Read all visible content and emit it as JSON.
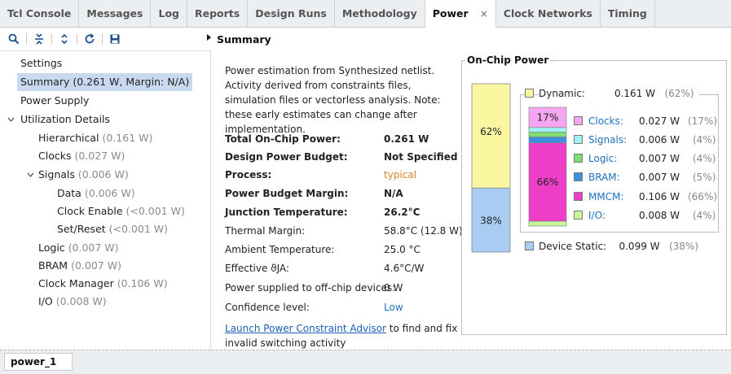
{
  "tabs": [
    {
      "label": "Tcl Console"
    },
    {
      "label": "Messages"
    },
    {
      "label": "Log"
    },
    {
      "label": "Reports"
    },
    {
      "label": "Design Runs"
    },
    {
      "label": "Methodology"
    },
    {
      "label": "Power",
      "active": true,
      "close": "×"
    },
    {
      "label": "Clock Networks"
    },
    {
      "label": "Timing"
    }
  ],
  "toolbar_icons": [
    "search-icon",
    "collapse-all-icon",
    "expand-all-icon",
    "refresh-icon",
    "save-icon"
  ],
  "summary_header": "Summary",
  "tree": {
    "settings": "Settings",
    "summary": "Summary (0.261 W, Margin: N/A)",
    "power_supply": "Power Supply",
    "utilization": "Utilization Details",
    "hierarchical": {
      "label": "Hierarchical",
      "value": "(0.161 W)"
    },
    "clocks": {
      "label": "Clocks",
      "value": "(0.027 W)"
    },
    "signals": {
      "label": "Signals",
      "value": "(0.006 W)"
    },
    "data": {
      "label": "Data",
      "value": "(0.006 W)"
    },
    "clock_enable": {
      "label": "Clock Enable",
      "value": "(<0.001 W)"
    },
    "set_reset": {
      "label": "Set/Reset",
      "value": "(<0.001 W)"
    },
    "logic": {
      "label": "Logic",
      "value": "(0.007 W)"
    },
    "bram": {
      "label": "BRAM",
      "value": "(0.007 W)"
    },
    "clock_manager": {
      "label": "Clock Manager",
      "value": "(0.106 W)"
    },
    "io": {
      "label": "I/O",
      "value": "(0.008 W)"
    }
  },
  "intro": "Power estimation from Synthesized netlist. Activity derived from constraints files, simulation files or vectorless analysis. Note: these early estimates can change after implementation.",
  "summary_rows": [
    {
      "label": "Total On-Chip Power:",
      "value": "0.261 W",
      "bold": true
    },
    {
      "label": "Design Power Budget:",
      "value": "Not Specified",
      "bold": true
    },
    {
      "label": "Process:",
      "value": "typical",
      "bold": true,
      "color": "orange"
    },
    {
      "label": "Power Budget Margin:",
      "value": "N/A",
      "bold": true
    },
    {
      "label": "Junction Temperature:",
      "value": "26.2°C",
      "bold": true
    },
    {
      "label": "Thermal Margin:",
      "value": "58.8°C (12.8 W)"
    },
    {
      "label": "Ambient Temperature:",
      "value": "25.0 °C"
    },
    {
      "label": "Effective ϑJA:",
      "value": "4.6°C/W"
    },
    {
      "label": "Power supplied to off-chip devices:",
      "value": "0 W"
    },
    {
      "label": "Confidence level:",
      "value": "Low",
      "color": "blue"
    }
  ],
  "advisor": {
    "link": "Launch Power Constraint Advisor",
    "text": " to find and fix invalid switching activity"
  },
  "onchip": {
    "title": "On-Chip Power",
    "dynamic": {
      "label": "Dynamic:",
      "value": "0.161 W",
      "pct": "(62%)",
      "bar_pct": "62%",
      "fraction": 0.62
    },
    "static": {
      "label": "Device Static:",
      "value": "0.099 W",
      "pct": "(38%)",
      "bar_pct": "38%",
      "fraction": 0.38
    },
    "breakdown": [
      {
        "label": "Clocks:",
        "value": "0.027 W",
        "pct": "(17%)",
        "color": "#f4a6f0",
        "fraction": 0.17,
        "bar_label": "17%"
      },
      {
        "label": "Signals:",
        "value": "0.006 W",
        "pct": "(4%)",
        "color": "#9ff3f5",
        "fraction": 0.04
      },
      {
        "label": "Logic:",
        "value": "0.007 W",
        "pct": "(4%)",
        "color": "#7fde6e",
        "fraction": 0.04
      },
      {
        "label": "BRAM:",
        "value": "0.007 W",
        "pct": "(5%)",
        "color": "#3d8fe0",
        "fraction": 0.05
      },
      {
        "label": "MMCM:",
        "value": "0.106 W",
        "pct": "(66%)",
        "color": "#ee3ec8",
        "fraction": 0.66,
        "bar_label": "66%"
      },
      {
        "label": "I/O:",
        "value": "0.008 W",
        "pct": "(4%)",
        "color": "#c7f59a",
        "fraction": 0.04
      }
    ],
    "colors": {
      "dynamic": "#fbf7a0",
      "static": "#a8ccf2"
    }
  },
  "bottom_tab": "power_1"
}
